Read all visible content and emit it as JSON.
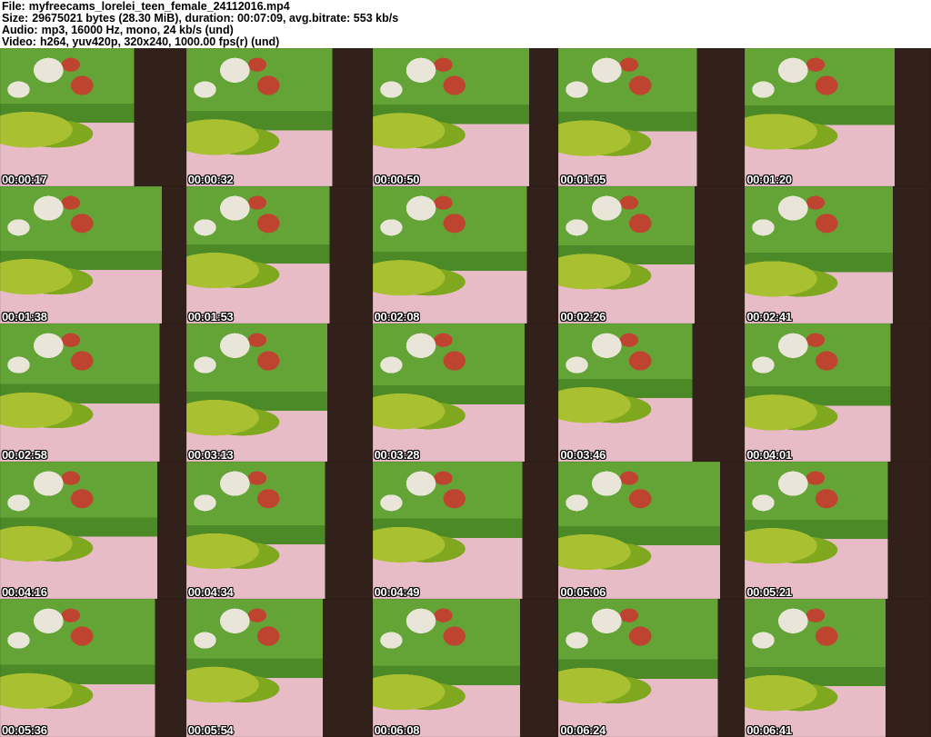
{
  "header": {
    "lines": [
      {
        "label": "File:",
        "value": "myfreecams_lorelei_teen_female_24112016.mp4"
      },
      {
        "label": "Size:",
        "value": "29675021 bytes (28.30 MiB), duration: 00:07:09, avg.bitrate: 553 kb/s"
      },
      {
        "label": "Audio:",
        "value": "mp3, 16000 Hz, mono, 24 kb/s (und)"
      },
      {
        "label": "Video:",
        "value": "h264, yuv420p, 320x240, 1000.00 fps(r) (und)"
      }
    ]
  },
  "sheet": {
    "columns": 5,
    "rows": 5,
    "thumbnails": [
      {
        "timestamp": "00:00:17"
      },
      {
        "timestamp": "00:00:32"
      },
      {
        "timestamp": "00:00:50"
      },
      {
        "timestamp": "00:01:05"
      },
      {
        "timestamp": "00:01:20"
      },
      {
        "timestamp": "00:01:38"
      },
      {
        "timestamp": "00:01:53"
      },
      {
        "timestamp": "00:02:08"
      },
      {
        "timestamp": "00:02:26"
      },
      {
        "timestamp": "00:02:41"
      },
      {
        "timestamp": "00:02:58"
      },
      {
        "timestamp": "00:03:13"
      },
      {
        "timestamp": "00:03:28"
      },
      {
        "timestamp": "00:03:46"
      },
      {
        "timestamp": "00:04:01"
      },
      {
        "timestamp": "00:04:16"
      },
      {
        "timestamp": "00:04:34"
      },
      {
        "timestamp": "00:04:49"
      },
      {
        "timestamp": "00:05:06"
      },
      {
        "timestamp": "00:05:21"
      },
      {
        "timestamp": "00:05:36"
      },
      {
        "timestamp": "00:05:54"
      },
      {
        "timestamp": "00:06:08"
      },
      {
        "timestamp": "00:06:24"
      },
      {
        "timestamp": "00:06:41"
      }
    ]
  },
  "palette": {
    "header_bg": "#ffffff",
    "header_text": "#000000",
    "timestamp_text": "#ffffff",
    "wall_green": "#64a437",
    "wall_green_dark": "#4c8a28",
    "pillow_green": "#a9c030",
    "pillow_green_dark": "#7fa81e",
    "bed_pink": "#e7bcc6",
    "door_brown": "#32211a",
    "poster_white": "#e9e6d9",
    "poster_red": "#bf4430"
  }
}
